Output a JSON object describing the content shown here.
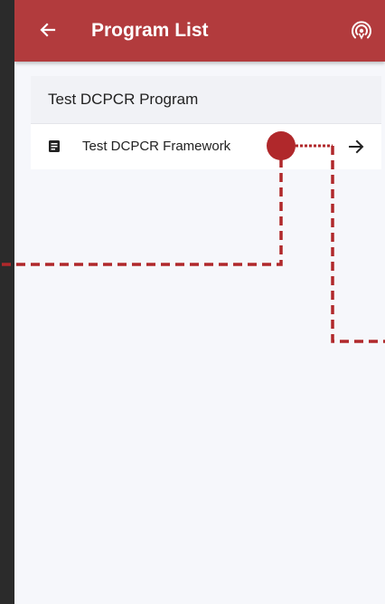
{
  "appbar": {
    "title": "Program List",
    "back_icon": "arrow-left-icon",
    "broadcast_icon": "broadcast-icon",
    "color": "#b23b3d"
  },
  "program": {
    "name": "Test DCPCR Program",
    "frameworks": [
      {
        "label": "Test DCPCR Framework",
        "icon": "document-icon",
        "action_icon": "arrow-right-icon"
      }
    ]
  },
  "annotation": {
    "color": "#b0282b"
  }
}
